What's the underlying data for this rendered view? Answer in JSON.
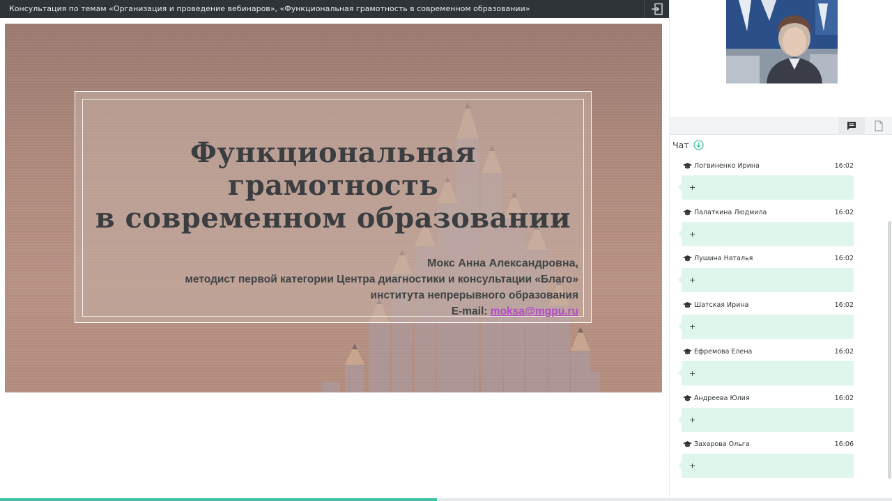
{
  "window": {
    "title": "Консультация по темам «Организация и проведение вебинаров», «Функциональная грамотность в современном образовании»",
    "exit_icon": "exit-icon"
  },
  "slide": {
    "title_lines": [
      "Функциональная",
      "грамотность",
      "в современном образовании"
    ],
    "author_name": "Мокс Анна Александровна,",
    "author_position": "методист первой категории Центра диагностики и консультации «Благо»",
    "author_institute": "института непрерывного образования",
    "email_label": "E-mail:",
    "email_value": "moksa@mgpu.ru"
  },
  "progress": {
    "fraction": 0.49,
    "color": "#3fc3a3"
  },
  "panel": {
    "tabs": [
      {
        "icon": "chat-icon",
        "active": true
      },
      {
        "icon": "document-icon",
        "active": false
      }
    ],
    "chat_title": "Чат",
    "chat_title_icon": "download-arrow-icon",
    "messages": [
      {
        "author": "Логвиненко Ирина",
        "time": "16:02",
        "text": "+"
      },
      {
        "author": "Палаткина Людмила",
        "time": "16:02",
        "text": "+"
      },
      {
        "author": "Лушина Наталья",
        "time": "16:02",
        "text": "+"
      },
      {
        "author": "Шатская Ирина",
        "time": "16:02",
        "text": "+"
      },
      {
        "author": "Ефремова Елена",
        "time": "16:02",
        "text": "+"
      },
      {
        "author": "Андреева Юлия",
        "time": "16:02",
        "text": "+"
      },
      {
        "author": "Захарова Ольга",
        "time": "16:06",
        "text": "+"
      }
    ]
  },
  "colors": {
    "topbar_bg": "#2e3438",
    "chat_bubble": "#dff6ed",
    "accent": "#3fc3a3",
    "link": "#b54cc9"
  }
}
